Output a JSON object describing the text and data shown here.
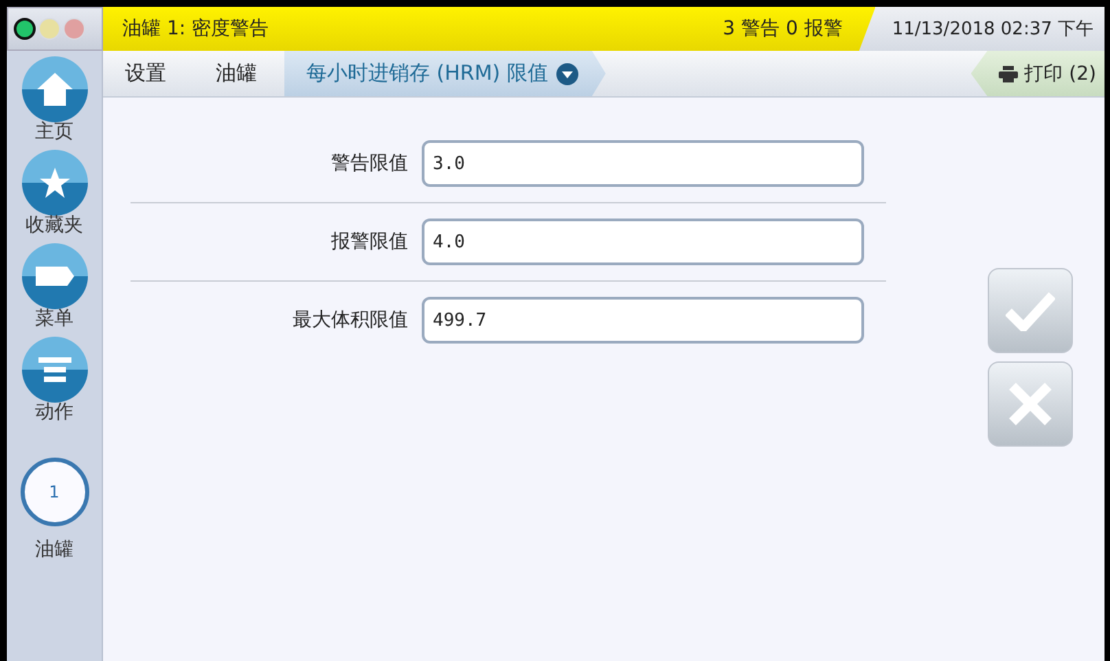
{
  "status_lights": [
    {
      "color": "#22c46a",
      "on": true
    },
    {
      "color": "#e8e0a0",
      "on": false
    },
    {
      "color": "#e0a0a0",
      "on": false
    }
  ],
  "alert_bar": {
    "title": "油罐 1: 密度警告",
    "summary": "3 警告 0 报警"
  },
  "datetime": "11/13/2018 02:37 下午",
  "breadcrumbs": [
    {
      "label": "设置",
      "selected": false
    },
    {
      "label": "油罐",
      "selected": false
    },
    {
      "label": "每小时进销存 (HRM) 限值",
      "selected": true
    }
  ],
  "print_button": {
    "label": "打印 (2)"
  },
  "sidebar": [
    {
      "kind": "home",
      "label": "主页"
    },
    {
      "kind": "star",
      "label": "收藏夹"
    },
    {
      "kind": "tag",
      "label": "菜单"
    },
    {
      "kind": "lines",
      "label": "动作"
    },
    {
      "kind": "tank",
      "number": "1",
      "label": "油罐"
    }
  ],
  "fields": [
    {
      "label": "警告限值",
      "value": "3.0"
    },
    {
      "label": "报警限值",
      "value": "4.0"
    },
    {
      "label": "最大体积限值",
      "value": "499.7"
    }
  ],
  "actions": [
    {
      "kind": "accept"
    },
    {
      "kind": "cancel"
    }
  ]
}
